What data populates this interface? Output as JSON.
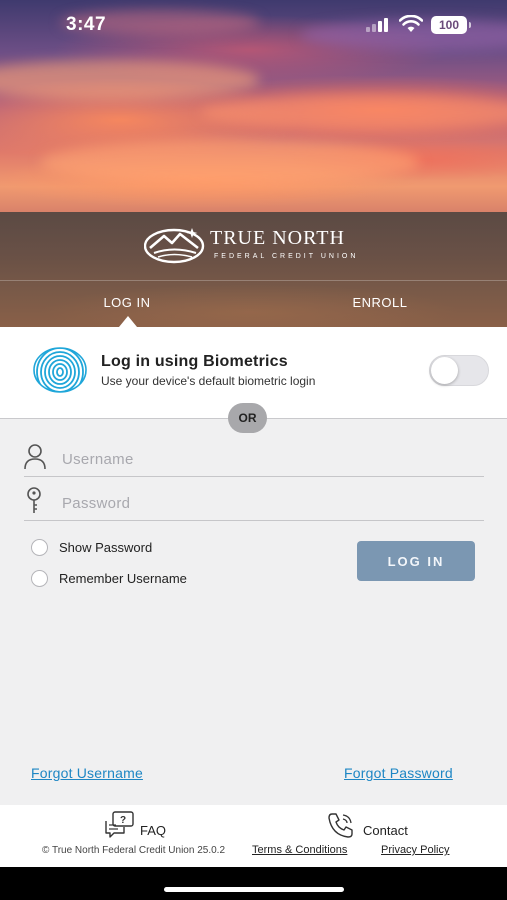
{
  "status_bar": {
    "time": "3:47",
    "battery": "100",
    "signal_icon": "cellular-signal-icon",
    "wifi_icon": "wifi-icon"
  },
  "brand": {
    "name": "TRUE NORTH",
    "subtitle": "FEDERAL CREDIT UNION",
    "logo_icon": "mountain-star-logo"
  },
  "tabs": [
    {
      "label": "LOG IN",
      "active": true
    },
    {
      "label": "ENROLL",
      "active": false
    }
  ],
  "biometrics": {
    "icon": "fingerprint-icon",
    "title": "Log in using Biometrics",
    "description": "Use your device's default biometric login",
    "enabled": false
  },
  "divider_label": "OR",
  "form": {
    "username": {
      "placeholder": "Username",
      "value": "",
      "icon": "user-icon"
    },
    "password": {
      "placeholder": "Password",
      "value": "",
      "icon": "key-icon"
    },
    "show_password": {
      "label": "Show Password",
      "checked": false
    },
    "remember_username": {
      "label": "Remember Username",
      "checked": false
    },
    "submit_label": "LOG IN"
  },
  "links": {
    "forgot_username": "Forgot Username",
    "forgot_password": "Forgot Password"
  },
  "footer": {
    "faq": {
      "label": "FAQ",
      "icon": "faq-chat-icon"
    },
    "contact": {
      "label": "Contact",
      "icon": "phone-icon"
    },
    "copyright": "© True North Federal Credit Union 25.0.2",
    "terms": "Terms & Conditions",
    "privacy": "Privacy Policy"
  },
  "colors": {
    "accent_link": "#1d86c4",
    "login_button": "#7b97b2"
  }
}
